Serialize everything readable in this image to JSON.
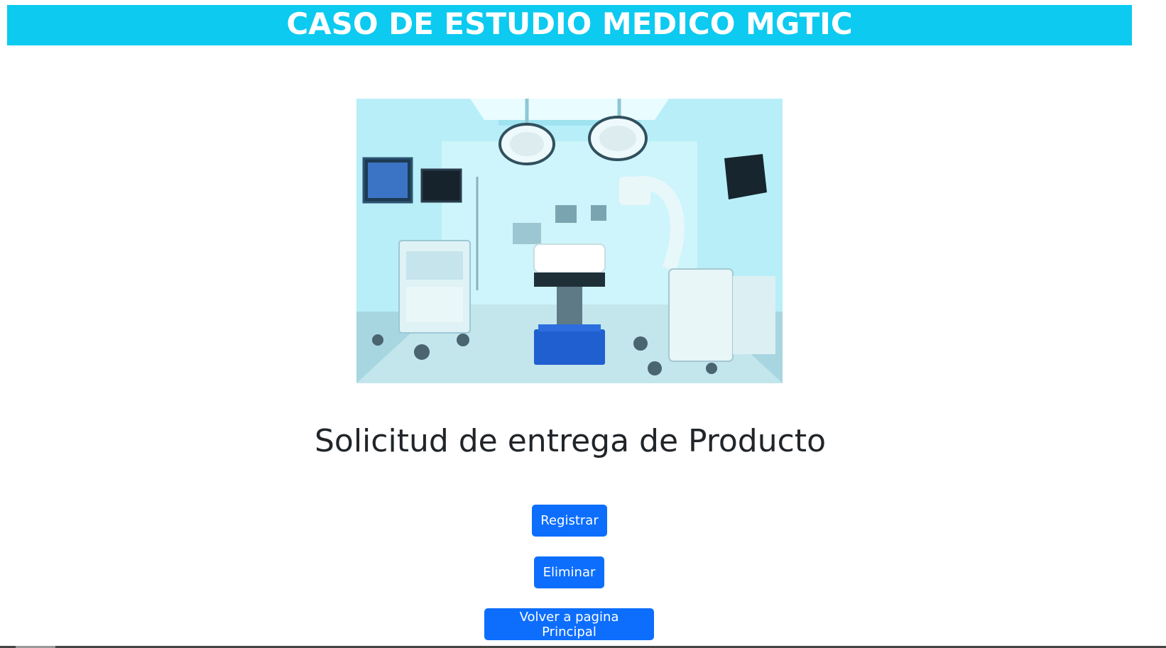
{
  "header": {
    "title": "CASO DE ESTUDIO MEDICO MGTIC",
    "background_color": "#0dcaf0"
  },
  "hero_image": {
    "alt": "operating-room-photo"
  },
  "main": {
    "title": "Solicitud de entrega de Producto"
  },
  "buttons": {
    "registrar": "Registrar",
    "eliminar": "Eliminar",
    "volver": "Volver a pagina Principal",
    "color": "#0d6efd"
  }
}
